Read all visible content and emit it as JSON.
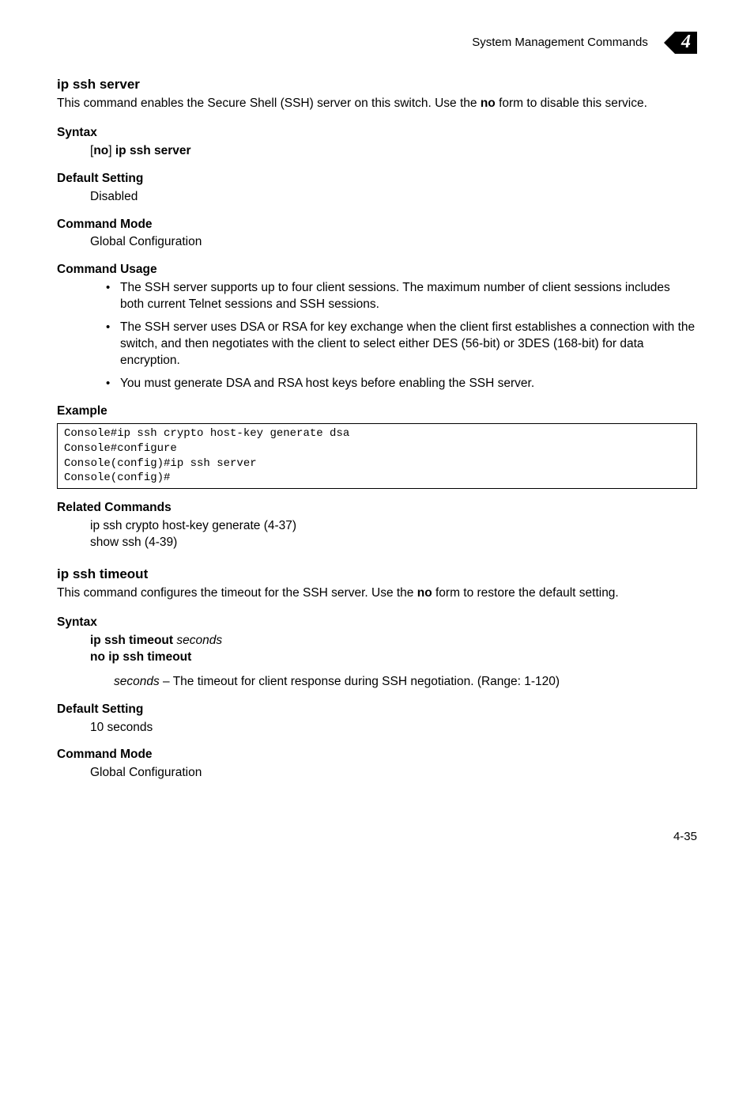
{
  "header": {
    "breadcrumb": "System Management Commands",
    "chapter": "4"
  },
  "section1": {
    "title": "ip ssh server",
    "intro_part1": "This command enables the Secure Shell (SSH) server on this switch. Use the ",
    "intro_bold": "no",
    "intro_part2": " form to disable this service.",
    "syntax_head": "Syntax",
    "syntax_pre": "[",
    "syntax_bracket_no": "no",
    "syntax_post": "] ",
    "syntax_cmd": "ip ssh server",
    "default_head": "Default Setting",
    "default_val": "Disabled",
    "mode_head": "Command Mode",
    "mode_val": "Global Configuration",
    "usage_head": "Command Usage",
    "usage_items": [
      "The SSH server supports up to four client sessions. The maximum number of client sessions includes both current Telnet sessions and SSH sessions.",
      "The SSH server uses DSA or RSA for key exchange when the client first establishes a connection with the switch, and then negotiates with the client to select either DES (56-bit) or 3DES (168-bit) for data encryption.",
      "You must generate DSA and RSA host keys before enabling the SSH server."
    ],
    "example_head": "Example",
    "example_code": "Console#ip ssh crypto host-key generate dsa\nConsole#configure\nConsole(config)#ip ssh server\nConsole(config)#",
    "related_head": "Related Commands",
    "related_1": "ip ssh crypto host-key generate (4-37)",
    "related_2": "show ssh (4-39)"
  },
  "section2": {
    "title": "ip ssh timeout",
    "intro_part1": "This command configures the timeout for the SSH server. Use the ",
    "intro_bold": "no",
    "intro_part2": " form to restore the default setting.",
    "syntax_head": "Syntax",
    "syntax_line1_bold": "ip ssh timeout",
    "syntax_line1_italic": " seconds",
    "syntax_line2": "no ip ssh timeout",
    "param_italic": "seconds",
    "param_desc": " – The timeout for client response during SSH negotiation. (Range: 1-120)",
    "default_head": "Default Setting",
    "default_val": "10 seconds",
    "mode_head": "Command Mode",
    "mode_val": "Global Configuration"
  },
  "footer": {
    "page": "4-35"
  }
}
